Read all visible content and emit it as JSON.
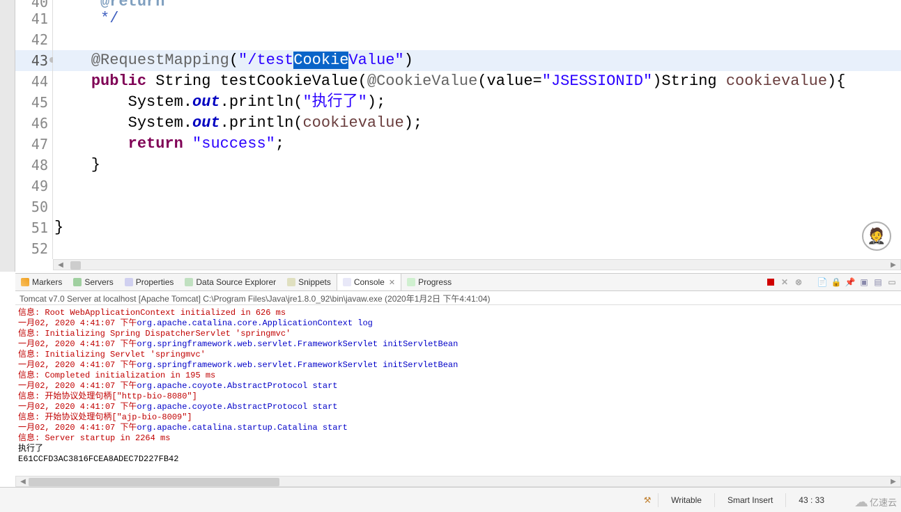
{
  "editor": {
    "lines": [
      {
        "num": 40,
        "segments": [
          {
            "cls": "tok-comment",
            "t": "     "
          },
          {
            "cls": "tok-doctag",
            "t": "@return"
          }
        ],
        "partial_top": true
      },
      {
        "num": 41,
        "segments": [
          {
            "cls": "tok-comment",
            "t": "     */"
          }
        ]
      },
      {
        "num": 42,
        "segments": []
      },
      {
        "num": 43,
        "highlighted": true,
        "override": true,
        "segments": [
          {
            "cls": "tok-annotation",
            "t": "    @RequestMapping"
          },
          {
            "cls": "tok-text",
            "t": "("
          },
          {
            "cls": "tok-string",
            "t": "\"/test"
          },
          {
            "cls": "selected-text",
            "t": "Cookie"
          },
          {
            "cls": "tok-string",
            "t": "Value\""
          },
          {
            "cls": "tok-text",
            "t": ")"
          }
        ]
      },
      {
        "num": 44,
        "segments": [
          {
            "cls": "tok-text",
            "t": "    "
          },
          {
            "cls": "tok-keyword",
            "t": "public"
          },
          {
            "cls": "tok-text",
            "t": " String testCookieValue("
          },
          {
            "cls": "tok-annotation",
            "t": "@CookieValue"
          },
          {
            "cls": "tok-text",
            "t": "(value="
          },
          {
            "cls": "tok-string",
            "t": "\"JSESSIONID\""
          },
          {
            "cls": "tok-text",
            "t": ")String "
          },
          {
            "cls": "tok-param",
            "t": "cookievalue"
          },
          {
            "cls": "tok-text",
            "t": "){"
          }
        ]
      },
      {
        "num": 45,
        "segments": [
          {
            "cls": "tok-text",
            "t": "        System."
          },
          {
            "cls": "tok-static",
            "t": "out"
          },
          {
            "cls": "tok-text",
            "t": ".println("
          },
          {
            "cls": "tok-string",
            "t": "\"执行了\""
          },
          {
            "cls": "tok-text",
            "t": ");"
          }
        ]
      },
      {
        "num": 46,
        "segments": [
          {
            "cls": "tok-text",
            "t": "        System."
          },
          {
            "cls": "tok-static",
            "t": "out"
          },
          {
            "cls": "tok-text",
            "t": ".println("
          },
          {
            "cls": "tok-param",
            "t": "cookievalue"
          },
          {
            "cls": "tok-text",
            "t": ");"
          }
        ]
      },
      {
        "num": 47,
        "segments": [
          {
            "cls": "tok-text",
            "t": "        "
          },
          {
            "cls": "tok-keyword",
            "t": "return"
          },
          {
            "cls": "tok-text",
            "t": " "
          },
          {
            "cls": "tok-string",
            "t": "\"success\""
          },
          {
            "cls": "tok-text",
            "t": ";"
          }
        ]
      },
      {
        "num": 48,
        "segments": [
          {
            "cls": "tok-text",
            "t": "    }"
          }
        ]
      },
      {
        "num": 49,
        "segments": []
      },
      {
        "num": 50,
        "segments": []
      },
      {
        "num": 51,
        "segments": [
          {
            "cls": "tok-text",
            "t": "}"
          }
        ]
      },
      {
        "num": 52,
        "segments": []
      }
    ]
  },
  "tabs": {
    "items": [
      {
        "icon": "markers",
        "label": "Markers"
      },
      {
        "icon": "servers",
        "label": "Servers"
      },
      {
        "icon": "properties",
        "label": "Properties"
      },
      {
        "icon": "datasource",
        "label": "Data Source Explorer"
      },
      {
        "icon": "snippets",
        "label": "Snippets"
      },
      {
        "icon": "console",
        "label": "Console",
        "active": true,
        "closable": true
      },
      {
        "icon": "progress",
        "label": "Progress"
      }
    ]
  },
  "console": {
    "header": "Tomcat v7.0 Server at localhost [Apache Tomcat] C:\\Program Files\\Java\\jre1.8.0_92\\bin\\javaw.exe (2020年1月2日 下午4:41:04)",
    "lines": [
      {
        "spans": [
          {
            "c": "red",
            "t": "信息: Root WebApplicationContext initialized in 626 ms"
          }
        ]
      },
      {
        "spans": [
          {
            "c": "red",
            "t": "一月02, 2020 4:41:07 下午"
          },
          {
            "c": "blue",
            "t": "org.apache.catalina.core.ApplicationContext log"
          }
        ]
      },
      {
        "spans": [
          {
            "c": "red",
            "t": "信息: Initializing Spring DispatcherServlet 'springmvc'"
          }
        ]
      },
      {
        "spans": [
          {
            "c": "red",
            "t": "一月02, 2020 4:41:07 下午"
          },
          {
            "c": "blue",
            "t": "org.springframework.web.servlet.FrameworkServlet initServletBean"
          }
        ]
      },
      {
        "spans": [
          {
            "c": "red",
            "t": "信息: Initializing Servlet 'springmvc'"
          }
        ]
      },
      {
        "spans": [
          {
            "c": "red",
            "t": "一月02, 2020 4:41:07 下午"
          },
          {
            "c": "blue",
            "t": "org.springframework.web.servlet.FrameworkServlet initServletBean"
          }
        ]
      },
      {
        "spans": [
          {
            "c": "red",
            "t": "信息: Completed initialization in 195 ms"
          }
        ]
      },
      {
        "spans": [
          {
            "c": "red",
            "t": "一月02, 2020 4:41:07 下午"
          },
          {
            "c": "blue",
            "t": "org.apache.coyote.AbstractProtocol start"
          }
        ]
      },
      {
        "spans": [
          {
            "c": "red",
            "t": "信息: 开始协议处理句柄[\"http-bio-8080\"]"
          }
        ]
      },
      {
        "spans": [
          {
            "c": "red",
            "t": "一月02, 2020 4:41:07 下午"
          },
          {
            "c": "blue",
            "t": "org.apache.coyote.AbstractProtocol start"
          }
        ]
      },
      {
        "spans": [
          {
            "c": "red",
            "t": "信息: 开始协议处理句柄[\"ajp-bio-8009\"]"
          }
        ]
      },
      {
        "spans": [
          {
            "c": "red",
            "t": "一月02, 2020 4:41:07 下午"
          },
          {
            "c": "blue",
            "t": "org.apache.catalina.startup.Catalina start"
          }
        ]
      },
      {
        "spans": [
          {
            "c": "red",
            "t": "信息: Server startup in 2264 ms"
          }
        ]
      },
      {
        "spans": [
          {
            "c": "black",
            "t": "执行了"
          }
        ]
      },
      {
        "spans": [
          {
            "c": "black",
            "t": "E61CCFD3AC3816FCEA8ADEC7D227FB42"
          }
        ]
      }
    ]
  },
  "status": {
    "writable": "Writable",
    "insert_mode": "Smart Insert",
    "cursor": "43 : 33",
    "logo_text": "亿速云"
  }
}
